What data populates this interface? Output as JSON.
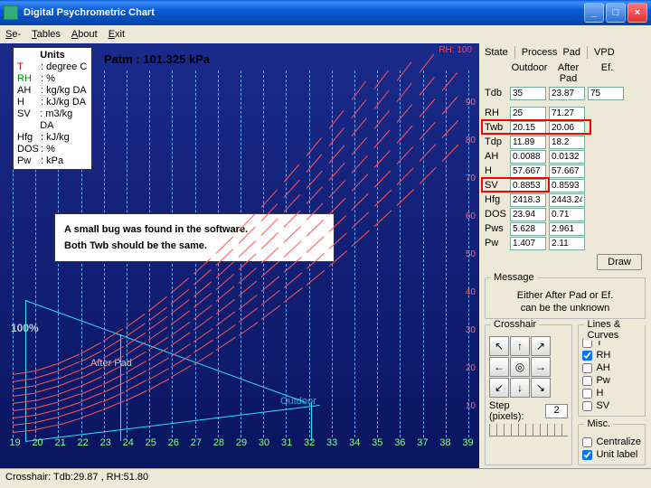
{
  "window": {
    "title": "Digital Psychrometric Chart"
  },
  "menu": {
    "se": "Se-",
    "tables": "Iables",
    "about": "About",
    "exit": "Exit"
  },
  "patm": "Patm : 101.325  kPa",
  "rh100": "RH: 100",
  "units": {
    "header": "Units",
    "rows": [
      {
        "k": "T",
        "v": "degree C",
        "cls": "red"
      },
      {
        "k": "RH",
        "v": "%",
        "cls": "green"
      },
      {
        "k": "AH",
        "v": "kg/kg DA",
        "cls": ""
      },
      {
        "k": "H",
        "v": "kJ/kg DA",
        "cls": ""
      },
      {
        "k": "SV",
        "v": "m3/kg DA",
        "cls": ""
      },
      {
        "k": "Hfg",
        "v": "kJ/kg",
        "cls": ""
      },
      {
        "k": "DOS",
        "v": "%",
        "cls": ""
      },
      {
        "k": "Pw",
        "v": "kPa",
        "cls": ""
      }
    ]
  },
  "bug": {
    "line1": "A small bug was found in the software.",
    "line2": "Both Twb should be the same."
  },
  "labels": {
    "hundred": "100%",
    "afterpad": "After Pad",
    "outdoor": "Outdoor"
  },
  "xaxis": [
    "19",
    "20",
    "21",
    "22",
    "23",
    "24",
    "25",
    "26",
    "27",
    "28",
    "29",
    "30",
    "31",
    "32",
    "33",
    "34",
    "35",
    "36",
    "37",
    "38",
    "39"
  ],
  "yaxis": [
    "90",
    "80",
    "70",
    "60",
    "50",
    "40",
    "30",
    "20",
    "10"
  ],
  "crosshair_status": "Crosshair: Tdb:29.87 , RH:51.80",
  "side": {
    "tabs": {
      "state": "State",
      "process": "Process",
      "pad": "Pad",
      "vpd": "VPD"
    },
    "cols": {
      "c1": "Outdoor",
      "c2": "After Pad",
      "c3": "Ef."
    },
    "rows": [
      {
        "k": "Tdb",
        "a": "35",
        "b": "23.87",
        "c": "75"
      },
      {
        "k": "RH",
        "a": "25",
        "b": "71.27",
        "c": ""
      },
      {
        "k": "Twb",
        "a": "20.15",
        "b": "20.06",
        "c": "",
        "hl": true
      },
      {
        "k": "Tdp",
        "a": "11.89",
        "b": "18.2",
        "c": ""
      },
      {
        "k": "AH",
        "a": "0.0088",
        "b": "0.0132",
        "c": ""
      },
      {
        "k": "H",
        "a": "57.667",
        "b": "57.667",
        "c": ""
      },
      {
        "k": "SV",
        "a": "0.8853",
        "b": "0.8593",
        "c": "",
        "hl2": true
      },
      {
        "k": "Hfg",
        "a": "2418.3",
        "b": "2443.24",
        "c": ""
      },
      {
        "k": "DOS",
        "a": "23.94",
        "b": "0.71",
        "c": ""
      },
      {
        "k": "Pws",
        "a": "5.628",
        "b": "2.961",
        "c": ""
      },
      {
        "k": "Pw",
        "a": "1.407",
        "b": "2.11",
        "c": ""
      }
    ],
    "draw": "Draw",
    "message": {
      "title": "Message",
      "l1": "Either After Pad or Ef.",
      "l2": "can be the unknown"
    },
    "crosshair": {
      "title": "Crosshair",
      "step": "Step (pixels):",
      "stepval": "2"
    },
    "lines": {
      "title": "Lines & Curves",
      "items": [
        {
          "k": "T",
          "c": false
        },
        {
          "k": "RH",
          "c": true
        },
        {
          "k": "AH",
          "c": false
        },
        {
          "k": "Pw",
          "c": false
        },
        {
          "k": "H",
          "c": false
        },
        {
          "k": "SV",
          "c": false
        }
      ]
    },
    "misc": {
      "title": "Misc.",
      "centralize": "Centralize",
      "unitlabel": "Unit label"
    }
  }
}
